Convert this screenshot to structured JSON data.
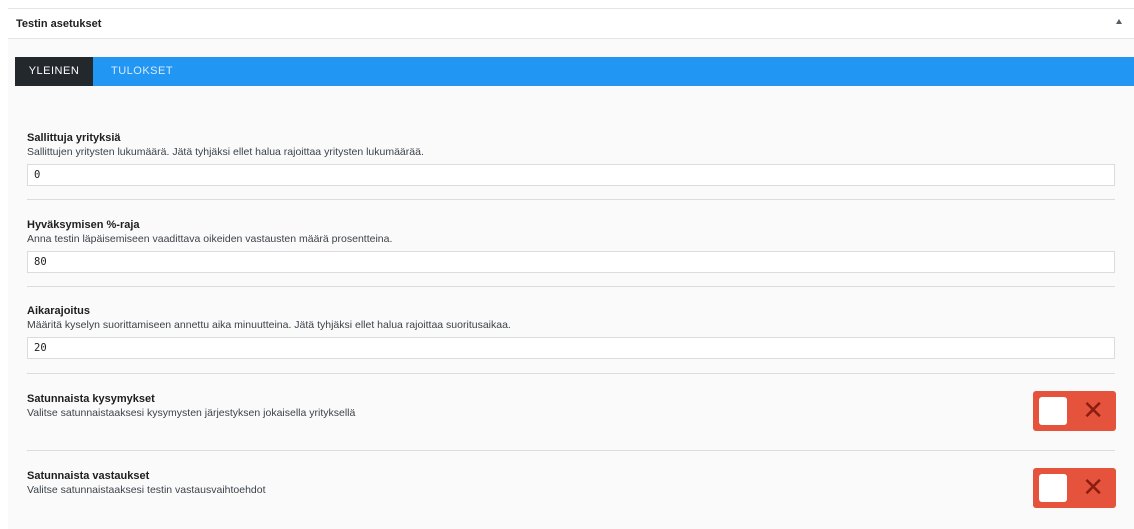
{
  "panel": {
    "title": "Testin asetukset",
    "collapse_icon": "arrow-up-icon"
  },
  "tabs": [
    {
      "label": "YLEINEN",
      "active": true
    },
    {
      "label": "TULOKSET",
      "active": false
    }
  ],
  "fields": [
    {
      "label": "Sallittuja yrityksiä",
      "description": "Sallittujen yritysten lukumäärä. Jätä tyhjäksi ellet halua rajoittaa yritysten lukumäärää.",
      "value": "0"
    },
    {
      "label": "Hyväksymisen %-raja",
      "description": "Anna testin läpäisemiseen vaadittava oikeiden vastausten määrä prosentteina.",
      "value": "80"
    },
    {
      "label": "Aikarajoitus",
      "description": "Määritä kyselyn suorittamiseen annettu aika minuutteina. Jätä tyhjäksi ellet halua rajoittaa suoritusaikaa.",
      "value": "20"
    }
  ],
  "toggles": [
    {
      "label": "Satunnaista kysymykset",
      "description": "Valitse satunnaistaaksesi kysymysten järjestyksen jokaisella yrityksellä",
      "state": "off",
      "icon": "x-icon",
      "symbol": "✕"
    },
    {
      "label": "Satunnaista vastaukset",
      "description": "Valitse satunnaistaaksesi testin vastausvaihtoehdot",
      "state": "off",
      "icon": "x-icon",
      "symbol": "✕"
    }
  ],
  "colors": {
    "tab_bar": "#2196f3",
    "tab_active": "#23282d",
    "toggle_off": "#e5533d"
  }
}
